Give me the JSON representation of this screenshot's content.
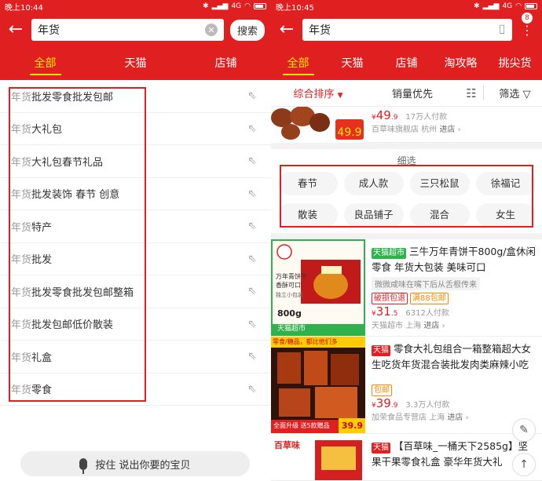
{
  "left": {
    "status": {
      "time": "晚上10:44",
      "network": "4G"
    },
    "search": {
      "value": "年货",
      "button": "搜索"
    },
    "tabs": [
      "全部",
      "天猫",
      "店铺"
    ],
    "keyword": "年货",
    "suggestions": [
      "批发零食批发包邮",
      "大礼包",
      "大礼包春节礼品",
      "批发装饰 春节 创意",
      "特产",
      "批发",
      "批发零食批发包邮整箱",
      "批发包邮低价散装",
      "礼盒",
      "零食"
    ],
    "voice": "按住 说出你要的宝贝"
  },
  "right": {
    "status": {
      "time": "晚上10:45",
      "network": "4G"
    },
    "search": {
      "value": "年货",
      "badge": "8"
    },
    "tabs": [
      "全部",
      "天猫",
      "店铺",
      "淘攻略",
      "挑尖货"
    ],
    "sort": {
      "default": "综合排序",
      "sales": "销量优先",
      "filter": "筛选"
    },
    "prod0": {
      "price_int": "49",
      "price_dec": ".9",
      "sold": "17万人付款",
      "shop": "百草味旗舰店",
      "city": "杭州",
      "enter": "进店"
    },
    "refine": {
      "title": "细选",
      "chips": [
        "春节",
        "成人款",
        "三只松鼠",
        "徐福记",
        "散装",
        "良品铺子",
        "混合",
        "女生"
      ]
    },
    "prod1": {
      "tag": "天猫超市",
      "title": "三牛万年青饼干800g/盒休闲零食 年货大包装 美味可口",
      "desc": "微微咸味在嘴下后从舌根传来",
      "promo1": "破损包退",
      "promo2": "满88包邮",
      "price_int": "31",
      "price_dec": ".5",
      "sold": "6312人付款",
      "shop": "天猫超市",
      "city": "上海",
      "enter": "进店",
      "img_label": "天猫超市",
      "img_text1": "万年青饼干",
      "img_text2": "香酥可口",
      "img_text3": "独立小包装",
      "img_weight": "800g"
    },
    "prod2": {
      "tag": "天猫",
      "title": "零食大礼包组合一箱整箱超大女生吃货年货混合装批发肉类麻辣小吃",
      "promo": "包邮",
      "price_int": "39",
      "price_dec": ".9",
      "sold": "3.3万人付款",
      "shop": "加荣食品专营店",
      "city": "上海",
      "enter": "进店",
      "img_top": "零食/糖品，都比他们多",
      "img_bottom": "全面升级 送5款赠品",
      "img_price": "39.9"
    },
    "prod3": {
      "tag": "天猫",
      "title": "【百草味_一桶天下2585g】坚果干果零食礼盒 豪华年货大礼",
      "img_brand": "百草味"
    }
  }
}
